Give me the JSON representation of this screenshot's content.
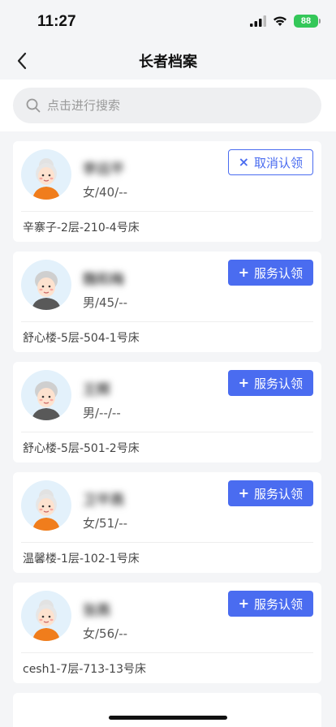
{
  "status_bar": {
    "time": "11:27",
    "battery": "88"
  },
  "nav": {
    "title": "长者档案"
  },
  "search": {
    "placeholder": "点击进行搜索"
  },
  "colors": {
    "accent": "#4a6cf0",
    "battery": "#34c759",
    "background": "#f4f5f7"
  },
  "residents": [
    {
      "name": "李远平",
      "meta": "女/40/--",
      "location": "辛寨子-2层-210-4号床",
      "action": {
        "icon": "×",
        "label": "取消认领",
        "style": "outline"
      },
      "avatar": "grandma-icon"
    },
    {
      "name": "魏和梅",
      "meta": "男/45/--",
      "location": "舒心楼-5层-504-1号床",
      "action": {
        "icon": "+",
        "label": "服务认领",
        "style": "primary"
      },
      "avatar": "grandpa-icon"
    },
    {
      "name": "王辉",
      "meta": "男/--/--",
      "location": "舒心楼-5层-501-2号床",
      "action": {
        "icon": "+",
        "label": "服务认领",
        "style": "primary"
      },
      "avatar": "grandpa-icon"
    },
    {
      "name": "卫平燕",
      "meta": "女/51/--",
      "location": "温馨楼-1层-102-1号床",
      "action": {
        "icon": "+",
        "label": "服务认领",
        "style": "primary"
      },
      "avatar": "grandma-icon"
    },
    {
      "name": "张燕",
      "meta": "女/56/--",
      "location": "cesh1-7层-713-13号床",
      "action": {
        "icon": "+",
        "label": "服务认领",
        "style": "primary"
      },
      "avatar": "grandma-icon"
    }
  ]
}
